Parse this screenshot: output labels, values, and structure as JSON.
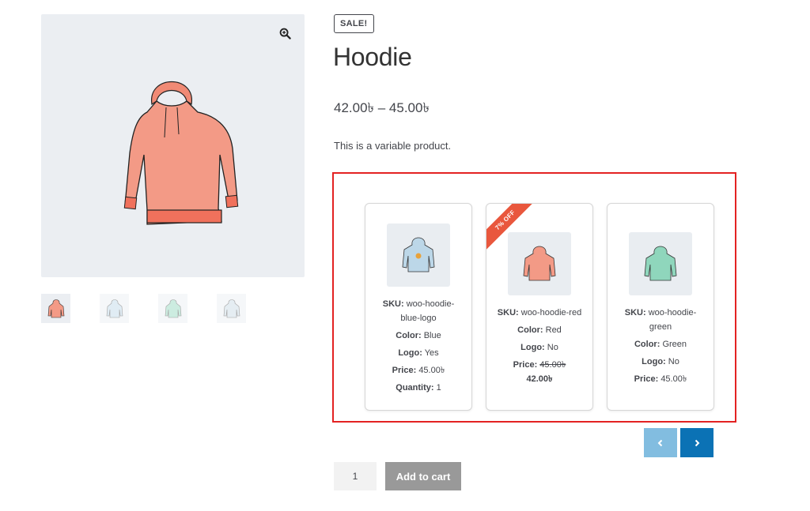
{
  "product": {
    "sale_badge": "SALE!",
    "title": "Hoodie",
    "price_range": "42.00৳ – 45.00৳",
    "description": "This is a variable product."
  },
  "gallery": {
    "main_image": "hoodie-red-image",
    "zoom_icon": "zoom-in-icon",
    "thumbnails": [
      "hoodie-red",
      "hoodie-blue-logo",
      "hoodie-green",
      "hoodie-blue"
    ]
  },
  "variations": [
    {
      "image": "hoodie-blue-logo",
      "sku_label": "SKU:",
      "sku": "woo-hoodie-blue-logo",
      "color_label": "Color:",
      "color": "Blue",
      "logo_label": "Logo:",
      "logo": "Yes",
      "price_label": "Price:",
      "price": "45.00৳",
      "quantity_label": "Quantity:",
      "quantity": "1"
    },
    {
      "image": "hoodie-red",
      "ribbon": "7% OFF",
      "sku_label": "SKU:",
      "sku": "woo-hoodie-red",
      "color_label": "Color:",
      "color": "Red",
      "logo_label": "Logo:",
      "logo": "No",
      "price_label": "Price:",
      "regular_price": "45.00৳",
      "sale_price": "42.00৳"
    },
    {
      "image": "hoodie-green",
      "sku_label": "SKU:",
      "sku": "woo-hoodie-green",
      "color_label": "Color:",
      "color": "Green",
      "logo_label": "Logo:",
      "logo": "No",
      "price_label": "Price:",
      "price": "45.00৳"
    }
  ],
  "carousel": {
    "prev_icon": "chevron-left-icon",
    "next_icon": "chevron-right-icon"
  },
  "cart": {
    "quantity_value": "1",
    "add_to_cart_label": "Add to cart"
  },
  "colors": {
    "highlight_border": "#e32222",
    "ribbon": "#e9573d",
    "nav_prev": "#82bde0",
    "nav_next": "#0b72b5",
    "add_to_cart_bg": "#999999"
  }
}
